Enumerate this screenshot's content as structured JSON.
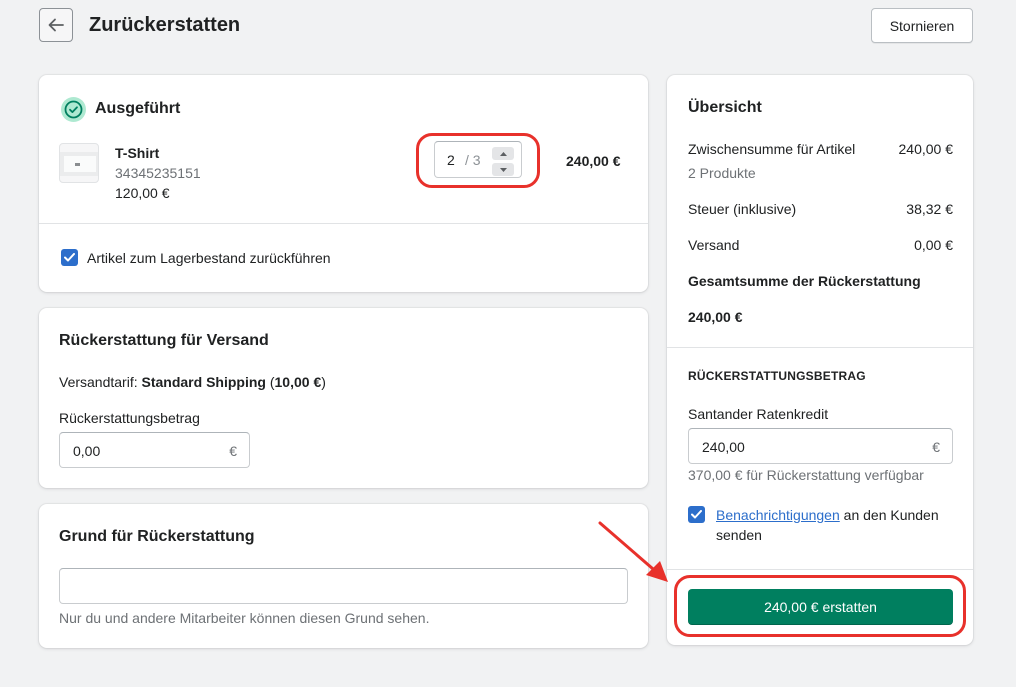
{
  "header": {
    "title": "Zurückerstatten",
    "cancel_label": "Stornieren"
  },
  "fulfilled": {
    "status": "Ausgeführt",
    "item": {
      "name": "T-Shirt",
      "sku": "34345235151",
      "price": "120,00 €",
      "quantity": "2",
      "quantity_max": "/ 3",
      "total": "240,00 €"
    },
    "restock_label": "Artikel zum Lagerbestand zurückführen",
    "restock_checked": true
  },
  "shipping_refund": {
    "title": "Rückerstattung für Versand",
    "rate_prefix": "Versandtarif:",
    "rate_name": "Standard Shipping",
    "rate_amount": "(10,00 €)",
    "amount_label": "Rückerstattungsbetrag",
    "amount_value": "0,00",
    "currency": "€"
  },
  "reason": {
    "title": "Grund für Rückerstattung",
    "value": "",
    "help": "Nur du und andere Mitarbeiter können diesen Grund sehen."
  },
  "summary": {
    "title": "Übersicht",
    "subtotal_label": "Zwischensumme für Artikel",
    "subtotal_value": "240,00 €",
    "subtotal_sub": "2 Produkte",
    "tax_label": "Steuer (inklusive)",
    "tax_value": "38,32 €",
    "shipping_label": "Versand",
    "shipping_value": "0,00 €",
    "total_label": "Gesamtsumme der Rückerstattung",
    "total_value": "240,00 €",
    "refund_heading": "RÜCKERSTATTUNGSBETRAG",
    "method_label": "Santander Ratenkredit",
    "method_value": "240,00",
    "currency": "€",
    "available": "370,00 € für Rückerstattung verfügbar",
    "notify_link": "Benachrichtigungen",
    "notify_rest": " an den Kunden senden",
    "notify_checked": true,
    "refund_button": "240,00 € erstatten"
  },
  "colors": {
    "primary": "#007f5f",
    "checkbox": "#2c6ecb",
    "highlight": "#e8312b",
    "success_icon": "#007f5f"
  }
}
